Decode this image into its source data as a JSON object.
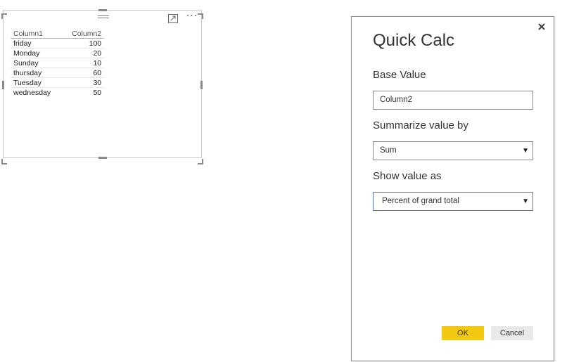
{
  "table": {
    "headers": [
      "Column1",
      "Column2"
    ],
    "rows": [
      [
        "friday",
        "100"
      ],
      [
        "Monday",
        "20"
      ],
      [
        "Sunday",
        "10"
      ],
      [
        "thursday",
        "60"
      ],
      [
        "Tuesday",
        "30"
      ],
      [
        "wednesday",
        "50"
      ]
    ]
  },
  "visual_icons": {
    "drag": "drag-handle-icon",
    "focus": "focus-mode-icon",
    "more": "more-options-icon",
    "more_glyph": "···"
  },
  "dialog": {
    "title": "Quick Calc",
    "close_glyph": "×",
    "base_value": {
      "label": "Base Value",
      "value": "Column2"
    },
    "summarize": {
      "label": "Summarize value by",
      "value": "Sum"
    },
    "show_as": {
      "label": "Show value as",
      "value": "Percent of grand total"
    },
    "ok_label": "OK",
    "cancel_label": "Cancel"
  },
  "colors": {
    "ok_button": "#f2c811",
    "cancel_button": "#e9e9e9",
    "active_border": "#5b7fa8"
  }
}
